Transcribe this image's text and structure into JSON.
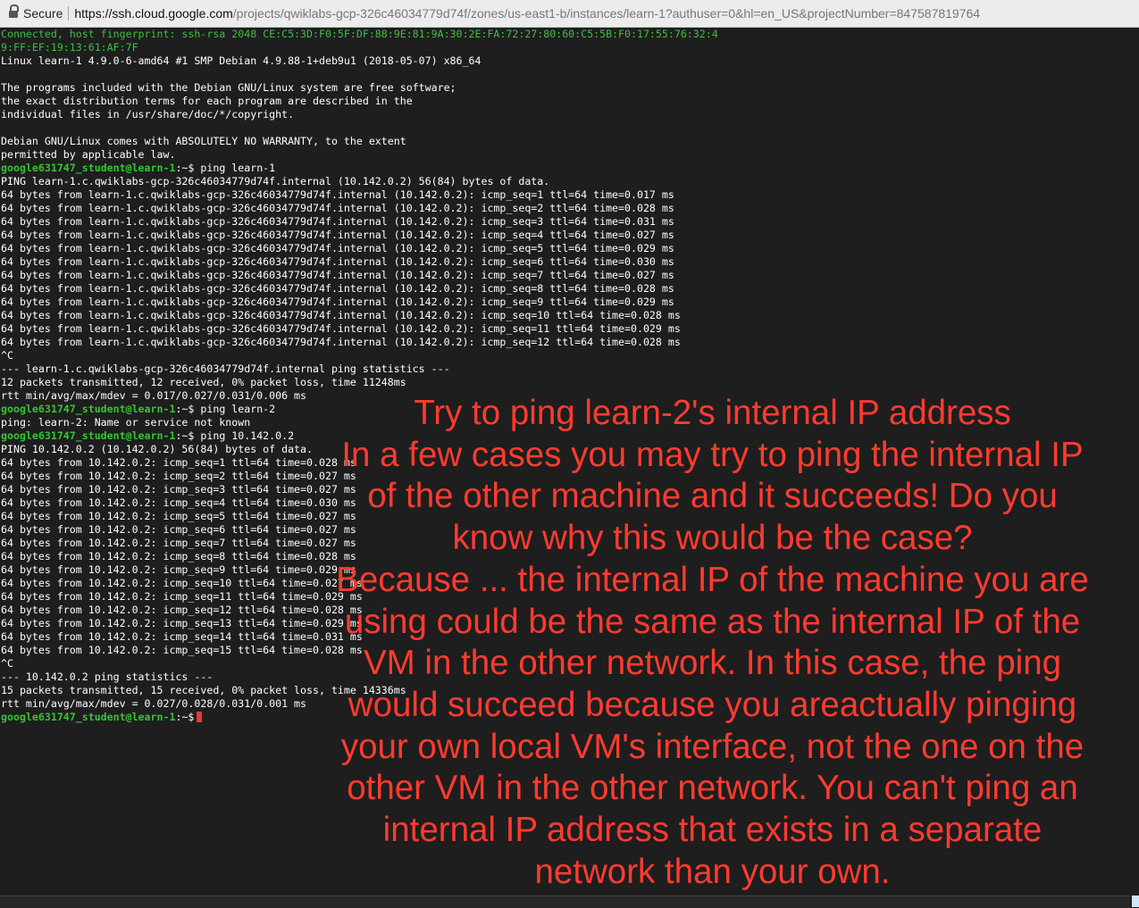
{
  "browser": {
    "secure_label": "Secure",
    "url_host": "https://ssh.cloud.google.com",
    "url_path": "/projects/qwiklabs-gcp-326c46034779d74f/zones/us-east1-b/instances/learn-1?authuser=0&hl=en_US&projectNumber=847587819764"
  },
  "terminal": {
    "prompt": "google631747_student@learn-1",
    "prompt_suffix": ":~$ ",
    "banner": [
      "Connected, host fingerprint: ssh-rsa 2048 CE:C5:3D:F0:5F:DF:88:9E:81:9A:30:2E:FA:72:27:80:60:C5:5B:F0:17:55:76:32:4",
      "9:FF:EF:19:13:61:AF:7F"
    ],
    "motd": [
      "Linux learn-1 4.9.0-6-amd64 #1 SMP Debian 4.9.88-1+deb9u1 (2018-05-07) x86_64",
      "",
      "The programs included with the Debian GNU/Linux system are free software;",
      "the exact distribution terms for each program are described in the",
      "individual files in /usr/share/doc/*/copyright.",
      "",
      "Debian GNU/Linux comes with ABSOLUTELY NO WARRANTY, to the extent",
      "permitted by applicable law."
    ],
    "cmd1": "ping learn-1",
    "out1": [
      "PING learn-1.c.qwiklabs-gcp-326c46034779d74f.internal (10.142.0.2) 56(84) bytes of data.",
      "64 bytes from learn-1.c.qwiklabs-gcp-326c46034779d74f.internal (10.142.0.2): icmp_seq=1 ttl=64 time=0.017 ms",
      "64 bytes from learn-1.c.qwiklabs-gcp-326c46034779d74f.internal (10.142.0.2): icmp_seq=2 ttl=64 time=0.028 ms",
      "64 bytes from learn-1.c.qwiklabs-gcp-326c46034779d74f.internal (10.142.0.2): icmp_seq=3 ttl=64 time=0.031 ms",
      "64 bytes from learn-1.c.qwiklabs-gcp-326c46034779d74f.internal (10.142.0.2): icmp_seq=4 ttl=64 time=0.027 ms",
      "64 bytes from learn-1.c.qwiklabs-gcp-326c46034779d74f.internal (10.142.0.2): icmp_seq=5 ttl=64 time=0.029 ms",
      "64 bytes from learn-1.c.qwiklabs-gcp-326c46034779d74f.internal (10.142.0.2): icmp_seq=6 ttl=64 time=0.030 ms",
      "64 bytes from learn-1.c.qwiklabs-gcp-326c46034779d74f.internal (10.142.0.2): icmp_seq=7 ttl=64 time=0.027 ms",
      "64 bytes from learn-1.c.qwiklabs-gcp-326c46034779d74f.internal (10.142.0.2): icmp_seq=8 ttl=64 time=0.028 ms",
      "64 bytes from learn-1.c.qwiklabs-gcp-326c46034779d74f.internal (10.142.0.2): icmp_seq=9 ttl=64 time=0.029 ms",
      "64 bytes from learn-1.c.qwiklabs-gcp-326c46034779d74f.internal (10.142.0.2): icmp_seq=10 ttl=64 time=0.028 ms",
      "64 bytes from learn-1.c.qwiklabs-gcp-326c46034779d74f.internal (10.142.0.2): icmp_seq=11 ttl=64 time=0.029 ms",
      "64 bytes from learn-1.c.qwiklabs-gcp-326c46034779d74f.internal (10.142.0.2): icmp_seq=12 ttl=64 time=0.028 ms",
      "^C",
      "--- learn-1.c.qwiklabs-gcp-326c46034779d74f.internal ping statistics ---",
      "12 packets transmitted, 12 received, 0% packet loss, time 11248ms",
      "rtt min/avg/max/mdev = 0.017/0.027/0.031/0.006 ms"
    ],
    "cmd2": "ping learn-2",
    "out2": [
      "ping: learn-2: Name or service not known"
    ],
    "cmd3": "ping 10.142.0.2",
    "out3": [
      "PING 10.142.0.2 (10.142.0.2) 56(84) bytes of data.",
      "64 bytes from 10.142.0.2: icmp_seq=1 ttl=64 time=0.028 ms",
      "64 bytes from 10.142.0.2: icmp_seq=2 ttl=64 time=0.027 ms",
      "64 bytes from 10.142.0.2: icmp_seq=3 ttl=64 time=0.027 ms",
      "64 bytes from 10.142.0.2: icmp_seq=4 ttl=64 time=0.030 ms",
      "64 bytes from 10.142.0.2: icmp_seq=5 ttl=64 time=0.027 ms",
      "64 bytes from 10.142.0.2: icmp_seq=6 ttl=64 time=0.027 ms",
      "64 bytes from 10.142.0.2: icmp_seq=7 ttl=64 time=0.027 ms",
      "64 bytes from 10.142.0.2: icmp_seq=8 ttl=64 time=0.028 ms",
      "64 bytes from 10.142.0.2: icmp_seq=9 ttl=64 time=0.029 ms",
      "64 bytes from 10.142.0.2: icmp_seq=10 ttl=64 time=0.027 ms",
      "64 bytes from 10.142.0.2: icmp_seq=11 ttl=64 time=0.029 ms",
      "64 bytes from 10.142.0.2: icmp_seq=12 ttl=64 time=0.028 ms",
      "64 bytes from 10.142.0.2: icmp_seq=13 ttl=64 time=0.029 ms",
      "64 bytes from 10.142.0.2: icmp_seq=14 ttl=64 time=0.031 ms",
      "64 bytes from 10.142.0.2: icmp_seq=15 ttl=64 time=0.028 ms",
      "^C",
      "--- 10.142.0.2 ping statistics ---",
      "15 packets transmitted, 15 received, 0% packet loss, time 14336ms",
      "rtt min/avg/max/mdev = 0.027/0.028/0.031/0.001 ms"
    ]
  },
  "annotation": {
    "color": "#ff3b30",
    "lines": [
      "Try to ping learn-2's internal IP address",
      "In a few cases you may try to ping the internal IP",
      "of the other machine and it succeeds! Do you",
      "know why this would be the case?",
      "Because ... the internal IP of the machine you are",
      "using could be the same as the internal IP of the",
      "VM in the other network. In this case, the ping",
      "would succeed because you areactually pinging",
      "your own local VM's interface, not the one on the",
      "other VM in the other network. You can't ping an",
      "internal IP address that exists in a separate",
      "network than your own."
    ]
  }
}
